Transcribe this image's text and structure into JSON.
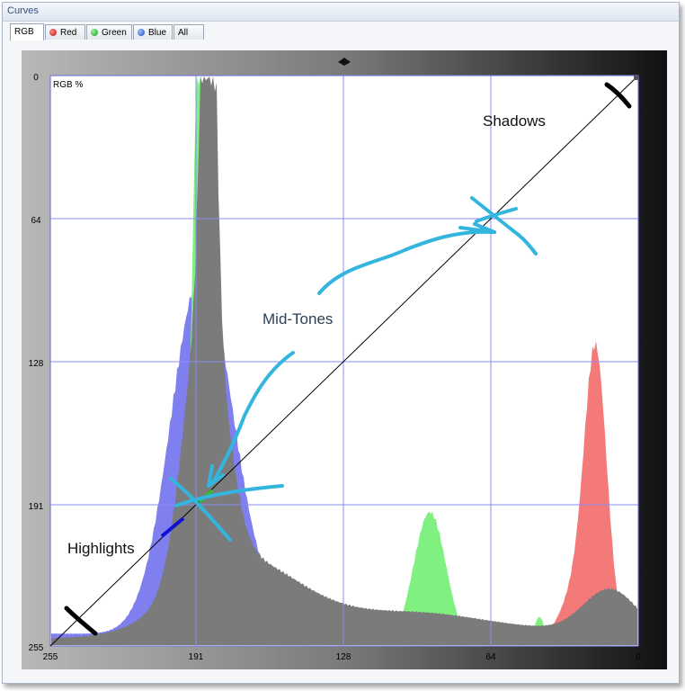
{
  "window": {
    "title": "Curves"
  },
  "tabs": [
    {
      "label": "RGB",
      "icon": ""
    },
    {
      "label": "Red",
      "icon": "red-dot-icon",
      "color": "#d42020"
    },
    {
      "label": "Green",
      "icon": "green-dot-icon",
      "color": "#22aa22"
    },
    {
      "label": "Blue",
      "icon": "blue-dot-icon",
      "color": "#2060d0"
    },
    {
      "label": "All",
      "icon": ""
    }
  ],
  "graph": {
    "channel_label": "RGB %",
    "y_ticks": [
      "0",
      "64",
      "128",
      "191",
      "255"
    ],
    "x_ticks": [
      "255",
      "191",
      "128",
      "64",
      "0"
    ]
  },
  "annotations": {
    "shadows": "Shadows",
    "midtones": "Mid-Tones",
    "highlights": "Highlights"
  },
  "colors": {
    "grid": "#8a8cf0",
    "red_hist": "#f47a7a",
    "green_hist": "#80f080",
    "blue_hist": "#7f7ff0",
    "gray_hist": "#7b7b7b",
    "scribble": "#33b5dd"
  }
}
